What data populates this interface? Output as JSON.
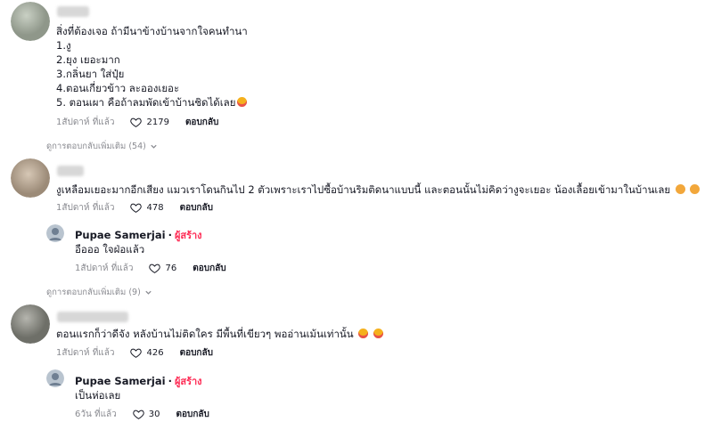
{
  "comments": [
    {
      "lines": [
        "สิ่งที่ต้องเจอ ถ้ามีนาข้างบ้านจากใจคนทำนา",
        "1.งู",
        "2.ยุง เยอะมาก",
        "3.กลิ่นยา ใส่ปุ๋ย",
        "4.ตอนเกี่ยวข้าว ละอองเยอะ",
        "5. ตอนเผา คือถ้าลมพัดเข้าบ้านชิดได้เลย"
      ],
      "emoji_icon": "laughing-emoji",
      "time": "1สัปดาห์ ที่แล้ว",
      "likes": "2179",
      "reply": "ตอบกลับ",
      "more_replies": "ดูการตอบกลับเพิ่มเติม (54)"
    },
    {
      "text": "งูเหลือมเยอะมากอีกเสียง แมวเราโดนกินไป 2 ตัวเพราะเราไปซื้อบ้านริมติดนาแบบนี้ และตอนนั้นไม่คิดว่างูจะเยอะ น้องเลื้อยเข้ามาในบ้านเลย",
      "emoji_icon": "sad-emoji",
      "time": "1สัปดาห์ ที่แล้ว",
      "likes": "478",
      "reply": "ตอบกลับ",
      "creator_reply": {
        "author": "Pupae Samerjai",
        "badge": "ผู้สร้าง",
        "text": "อือออ ใจฝ่อแล้ว",
        "time": "1สัปดาห์ ที่แล้ว",
        "likes": "76",
        "reply": "ตอบกลับ"
      },
      "more_replies": "ดูการตอบกลับเพิ่มเติม (9)"
    },
    {
      "text": "ตอนแรกก็ว่าดีจัง หลังบ้านไม่ติดใคร มีพื้นที่เขียวๆ พออ่านเม้นเท่านั้น",
      "emoji_icon": "sweat-smile-emoji",
      "time": "1สัปดาห์ ที่แล้ว",
      "likes": "426",
      "reply": "ตอบกลับ",
      "creator_reply": {
        "author": "Pupae Samerjai",
        "badge": "ผู้สร้าง",
        "text": "เป็นห่อเลย",
        "time": "6วัน ที่แล้ว",
        "likes": "30",
        "reply": "ตอบกลับ"
      }
    }
  ],
  "colors": {
    "creator_badge": "#fe2c55",
    "meta_gray": "#8a8b91",
    "text": "#161823"
  }
}
